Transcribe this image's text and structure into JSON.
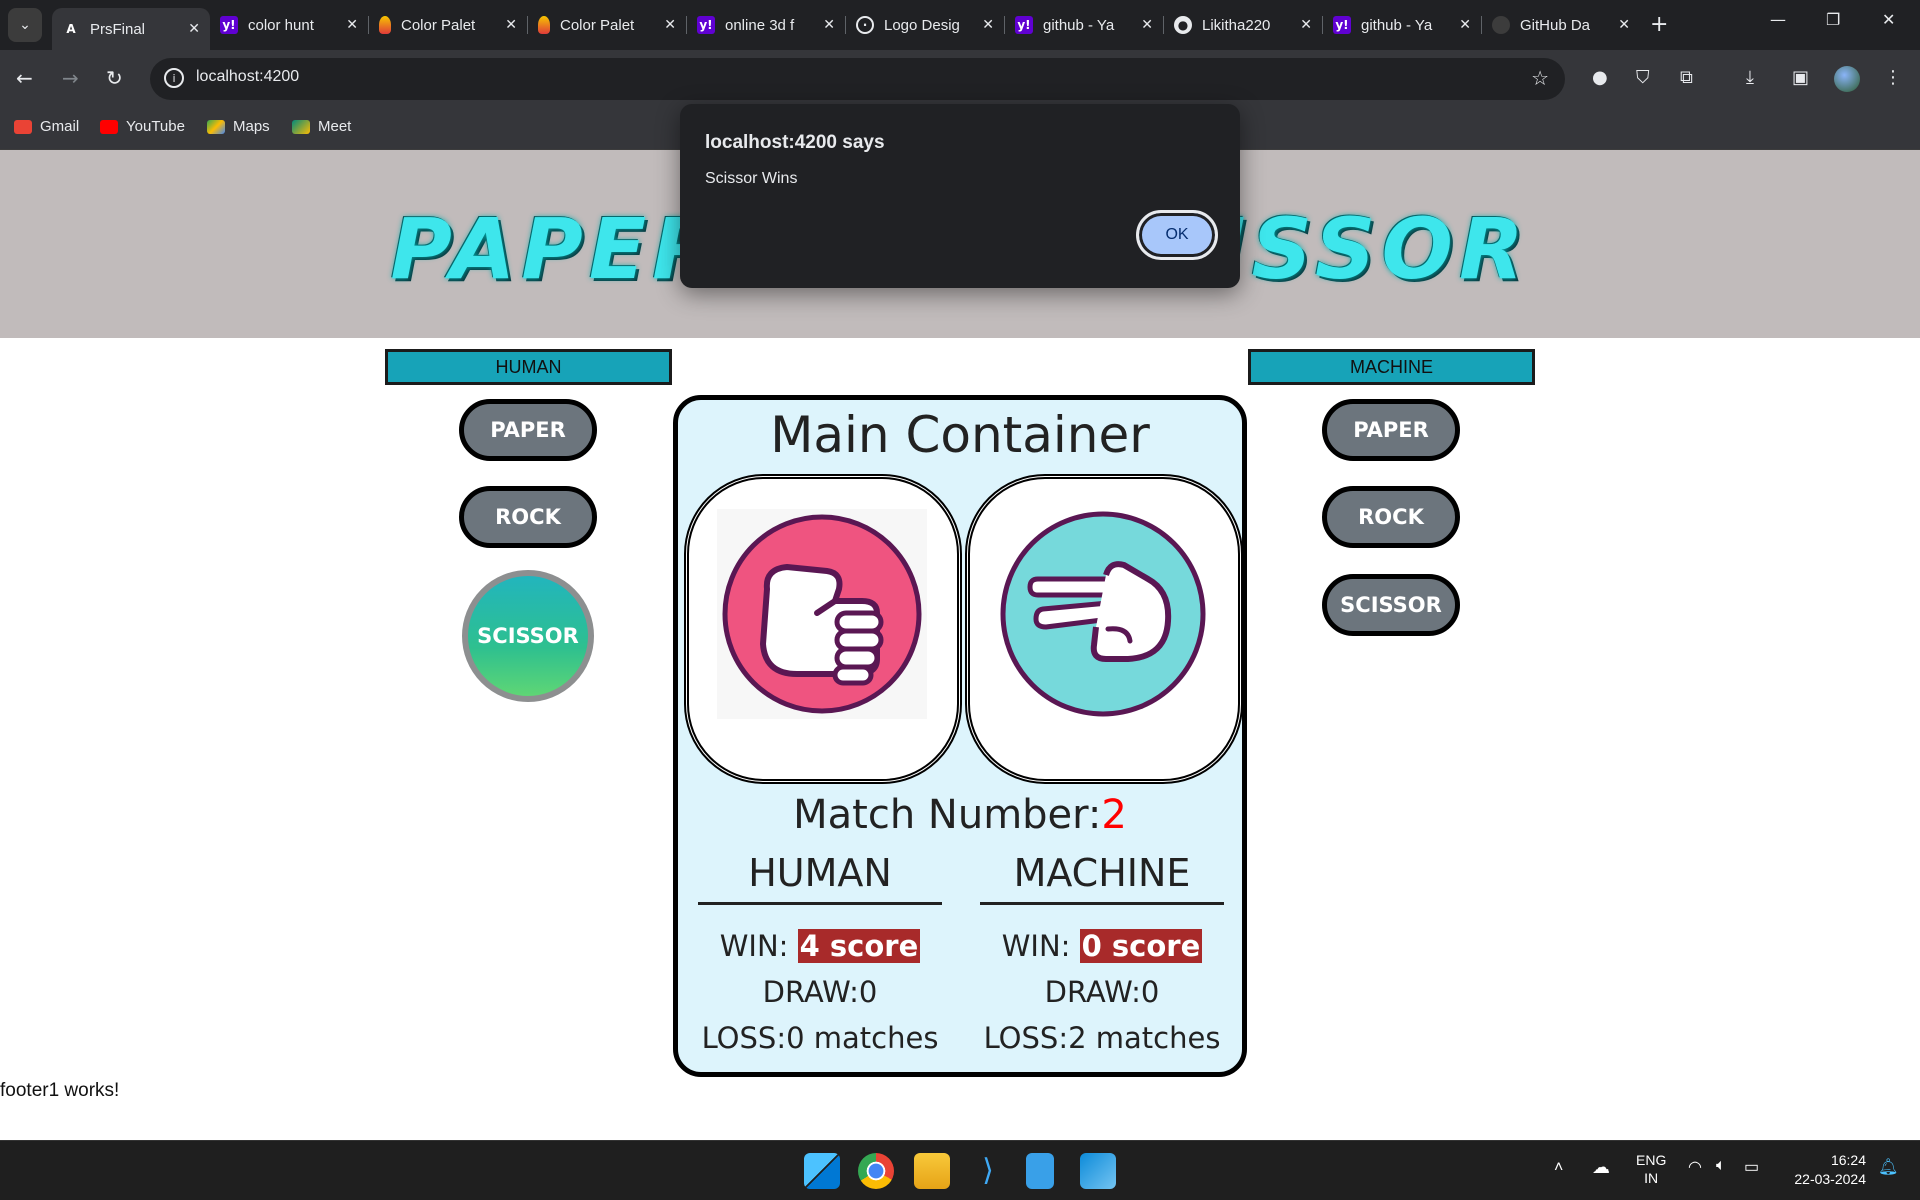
{
  "browser": {
    "tabs": [
      {
        "title": "PrsFinal",
        "icon": "angular-icon",
        "active": true
      },
      {
        "title": "color hunt",
        "icon": "yahoo-icon"
      },
      {
        "title": "Color Palet",
        "icon": "palette-icon"
      },
      {
        "title": "Color Palet",
        "icon": "palette-icon"
      },
      {
        "title": "online 3d f",
        "icon": "yahoo-icon"
      },
      {
        "title": "Logo Desig",
        "icon": "globe-icon"
      },
      {
        "title": "github - Ya",
        "icon": "yahoo-icon"
      },
      {
        "title": "Likitha220",
        "icon": "github-icon"
      },
      {
        "title": "github - Ya",
        "icon": "yahoo-icon"
      },
      {
        "title": "GitHub Da",
        "icon": "github-icon"
      }
    ],
    "url": "localhost:4200",
    "bookmarks": [
      {
        "label": "Gmail",
        "color": "#ea4335"
      },
      {
        "label": "YouTube",
        "color": "#ff0000"
      },
      {
        "label": "Maps",
        "color": "#34a853"
      },
      {
        "label": "Meet",
        "color": "#00897b"
      }
    ]
  },
  "alert": {
    "title": "localhost:4200 says",
    "message": "Scissor Wins",
    "ok_label": "OK"
  },
  "game": {
    "banner_title": "PAPER ROCK SCISSOR",
    "human": {
      "header": "HUMAN",
      "choices": [
        "PAPER",
        "ROCK",
        "SCISSOR"
      ],
      "selected": "SCISSOR"
    },
    "machine": {
      "header": "MACHINE",
      "choices": [
        "PAPER",
        "ROCK",
        "SCISSOR"
      ]
    },
    "main": {
      "title": "Main Container",
      "human_hand": "rock",
      "machine_hand": "scissor",
      "match_label": "Match Number:",
      "match_number": "2",
      "human_stats": {
        "header": "HUMAN",
        "win_label": "WIN: ",
        "win_value": "4 score",
        "draw": "DRAW:0",
        "loss": "LOSS:0 matches"
      },
      "machine_stats": {
        "header": "MACHINE",
        "win_label": "WIN: ",
        "win_value": "0 score",
        "draw": "DRAW:0",
        "loss": "LOSS:2 matches"
      }
    },
    "footer": "footer1 works!"
  },
  "taskbar": {
    "lang_top": "ENG",
    "lang_bottom": "IN",
    "time": "16:24",
    "date": "22-03-2024"
  },
  "colors": {
    "rock_circle": "#ef5480",
    "scissor_circle": "#76d9db",
    "hand_outline": "#5a1753"
  }
}
